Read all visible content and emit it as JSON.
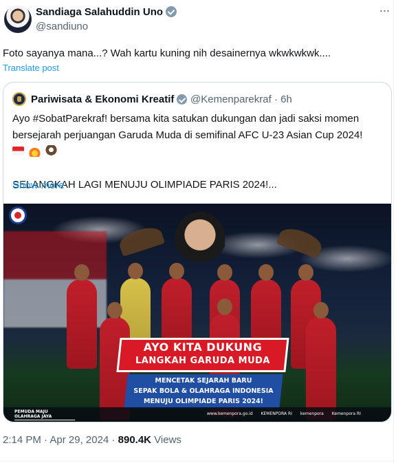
{
  "author": {
    "name": "Sandiaga Salahuddin Uno",
    "handle": "@sandiuno"
  },
  "more_label": "···",
  "tweet_text": "Foto sayanya mana...? Wah kartu kuning nih desainernya wkwkwkwk....",
  "translate_label": "Translate post",
  "quote": {
    "name": "Pariwisata & Ekonomi Kreatif",
    "handle": "@Kemenparekraf",
    "dot": "·",
    "time": "6h",
    "lines": [
      "Ayo #SobatParekraf! bersama kita satukan dukungan dan jadi saksi momen",
      "bersejarah perjuangan Garuda Muda di semifinal AFC U-23 Asian Cup 2024!"
    ],
    "emojis": [
      "flag-indonesia",
      "fire",
      "eagle"
    ],
    "line3": "SELANGKAH LAGI MENUJU OLIMPIADE PARIS 2024!...",
    "show_more": "Show more",
    "poster": {
      "title_line1": "AYO KITA DUKUNG",
      "title_line2": "LANGKAH GARUDA MUDA",
      "sub_line1": "MENCETAK SEJARAH BARU",
      "sub_line2": "SEPAK BOLA & OLAHRAGA INDONESIA",
      "sub_line3": "MENUJU OLIMPIADE PARIS 2024!",
      "footer_left_1": "PEMUDA MAJU",
      "footer_left_2": "OLAHRAGA JAYA",
      "footer_links": [
        "www.kemenpora.go.id",
        "KEMENPORA RI",
        "kemenpora",
        "Kemenpora RI"
      ]
    }
  },
  "meta": {
    "time": "2:14 PM",
    "dot": "·",
    "date": "Apr 29, 2024",
    "views_count": "890.4K",
    "views_label": "Views"
  },
  "colors": {
    "link": "#1d9bf0",
    "verified": "#829aab",
    "secondary_text": "#536471",
    "banner_red": "#d71a25",
    "banner_blue": "#1f4ea3"
  }
}
